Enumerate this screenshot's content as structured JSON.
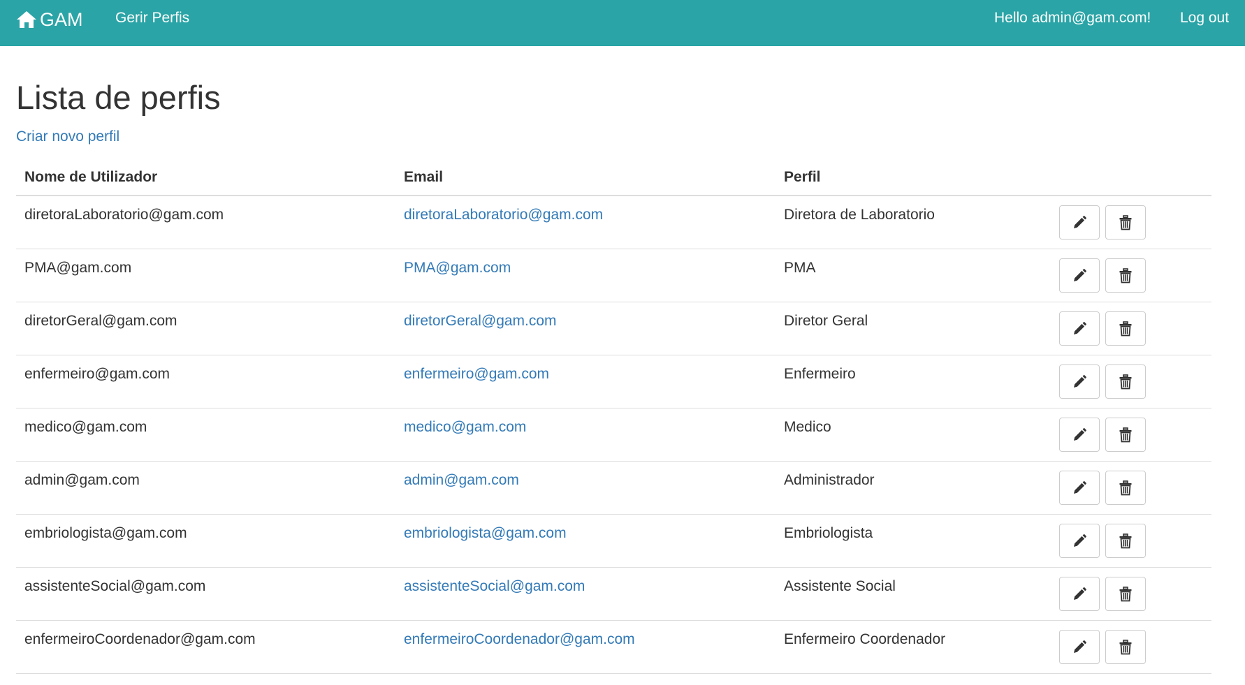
{
  "navbar": {
    "brand": "GAM",
    "brand_icon": "home-icon",
    "manage_profiles": "Gerir Perfis",
    "greeting": "Hello admin@gam.com!",
    "logout": "Log out",
    "background": "#2aa4a6"
  },
  "page": {
    "title": "Lista de perfis",
    "create_link": "Criar novo perfil"
  },
  "table": {
    "headers": {
      "username": "Nome de Utilizador",
      "email": "Email",
      "role": "Perfil"
    },
    "rows": [
      {
        "username": "diretoraLaboratorio@gam.com",
        "email": "diretoraLaboratorio@gam.com",
        "role": "Diretora de Laboratorio"
      },
      {
        "username": "PMA@gam.com",
        "email": "PMA@gam.com",
        "role": "PMA"
      },
      {
        "username": "diretorGeral@gam.com",
        "email": "diretorGeral@gam.com",
        "role": "Diretor Geral"
      },
      {
        "username": "enfermeiro@gam.com",
        "email": "enfermeiro@gam.com",
        "role": "Enfermeiro"
      },
      {
        "username": "medico@gam.com",
        "email": "medico@gam.com",
        "role": "Medico"
      },
      {
        "username": "admin@gam.com",
        "email": "admin@gam.com",
        "role": "Administrador"
      },
      {
        "username": "embriologista@gam.com",
        "email": "embriologista@gam.com",
        "role": "Embriologista"
      },
      {
        "username": "assistenteSocial@gam.com",
        "email": "assistenteSocial@gam.com",
        "role": "Assistente Social"
      },
      {
        "username": "enfermeiroCoordenador@gam.com",
        "email": "enfermeiroCoordenador@gam.com",
        "role": "Enfermeiro Coordenador"
      }
    ],
    "row_actions": [
      "pencil-icon",
      "trash-icon"
    ]
  },
  "colors": {
    "link": "#337ab7",
    "text": "#333333",
    "border": "#dddddd"
  }
}
